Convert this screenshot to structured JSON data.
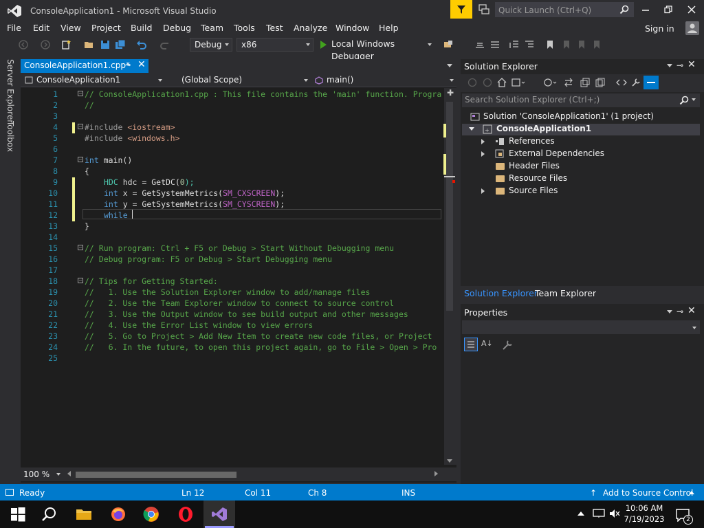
{
  "window": {
    "title": "ConsoleApplication1 - Microsoft Visual Studio",
    "quick_launch_placeholder": "Quick Launch (Ctrl+Q)"
  },
  "menu": {
    "items": [
      "File",
      "Edit",
      "View",
      "Project",
      "Build",
      "Debug",
      "Team",
      "Tools",
      "Test",
      "Analyze",
      "Window",
      "Help"
    ],
    "sign_in": "Sign in"
  },
  "toolbar": {
    "config": "Debug",
    "platform": "x86",
    "run_label": "Local Windows Debugger"
  },
  "left_rail": {
    "tabs": [
      "Server Explorer",
      "Toolbox"
    ]
  },
  "editor": {
    "tab_title": "ConsoleApplication1.cpp*",
    "project_combo": "ConsoleApplication1",
    "scope_combo": "(Global Scope)",
    "member_combo": "main()",
    "zoom": "100 %",
    "lines": [
      {
        "n": "1",
        "t": "// ConsoleApplication1.cpp : This file contains the 'main' function. Progra"
      },
      {
        "n": "2",
        "t": "//"
      },
      {
        "n": "3",
        "t": ""
      },
      {
        "n": "4",
        "t": "#include <iostream>"
      },
      {
        "n": "5",
        "t": "#include <windows.h>"
      },
      {
        "n": "6",
        "t": ""
      },
      {
        "n": "7",
        "t": "int main()"
      },
      {
        "n": "8",
        "t": "{"
      },
      {
        "n": "9",
        "t": "HDC hdc = GetDC(0);"
      },
      {
        "n": "10",
        "t": "int x = GetSystemMetrics(SM_CXSCREEN);"
      },
      {
        "n": "11",
        "t": "int y = GetSystemMetrics(SM_CYSCREEN);"
      },
      {
        "n": "12",
        "t": "while "
      },
      {
        "n": "13",
        "t": "}"
      },
      {
        "n": "14",
        "t": ""
      },
      {
        "n": "15",
        "t": "// Run program: Ctrl + F5 or Debug > Start Without Debugging menu"
      },
      {
        "n": "16",
        "t": "// Debug program: F5 or Debug > Start Debugging menu"
      },
      {
        "n": "17",
        "t": ""
      },
      {
        "n": "18",
        "t": "// Tips for Getting Started:"
      },
      {
        "n": "19",
        "t": "//   1. Use the Solution Explorer window to add/manage files"
      },
      {
        "n": "20",
        "t": "//   2. Use the Team Explorer window to connect to source control"
      },
      {
        "n": "21",
        "t": "//   3. Use the Output window to see build output and other messages"
      },
      {
        "n": "22",
        "t": "//   4. Use the Error List window to view errors"
      },
      {
        "n": "23",
        "t": "//   5. Go to Project > Add New Item to create new code files, or Project"
      },
      {
        "n": "24",
        "t": "//   6. In the future, to open this project again, go to File > Open > Pro"
      },
      {
        "n": "25",
        "t": ""
      }
    ]
  },
  "solution_explorer": {
    "title": "Solution Explorer",
    "search_placeholder": "Search Solution Explorer (Ctrl+;)",
    "solution": "Solution 'ConsoleApplication1' (1 project)",
    "project": "ConsoleApplication1",
    "nodes": [
      "References",
      "External Dependencies",
      "Header Files",
      "Resource Files",
      "Source Files"
    ],
    "tabs": [
      "Solution Explorer",
      "Team Explorer"
    ]
  },
  "properties": {
    "title": "Properties"
  },
  "status": {
    "ready": "Ready",
    "line": "Ln 12",
    "col": "Col 11",
    "ch": "Ch 8",
    "mode": "INS",
    "source_control": "Add to Source Control"
  },
  "taskbar": {
    "time": "10:06 AM",
    "date": "7/19/2023",
    "notifications": "2"
  },
  "colors": {
    "accent": "#007acc",
    "keyword": "#569cd6",
    "comment": "#57a64a",
    "macro": "#bd63c5",
    "line_number": "#2b91af"
  }
}
